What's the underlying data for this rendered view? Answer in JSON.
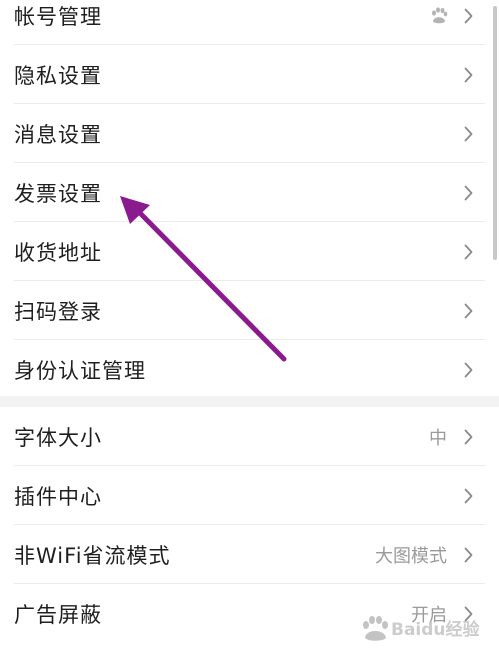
{
  "settings": {
    "group1": [
      {
        "label": "帐号管理",
        "value": "",
        "trailing_icon": "baidu-paw-icon"
      },
      {
        "label": "隐私设置",
        "value": ""
      },
      {
        "label": "消息设置",
        "value": ""
      },
      {
        "label": "发票设置",
        "value": ""
      },
      {
        "label": "收货地址",
        "value": ""
      },
      {
        "label": "扫码登录",
        "value": ""
      },
      {
        "label": "身份认证管理",
        "value": ""
      }
    ],
    "group2": [
      {
        "label": "字体大小",
        "value": "中"
      },
      {
        "label": "插件中心",
        "value": ""
      },
      {
        "label": "非WiFi省流模式",
        "value": "大图模式"
      },
      {
        "label": "广告屏蔽",
        "value": "开启"
      }
    ]
  },
  "annotation": {
    "color": "#8a1a8e",
    "points_to": "发票设置"
  },
  "watermark": {
    "text": "Baidu经验",
    "icon": "baidu-paw-logo"
  },
  "colors": {
    "label": "#1f1f1f",
    "value": "#9a9a9a",
    "divider": "#ebebeb",
    "section_gap": "#f3f3f3"
  }
}
